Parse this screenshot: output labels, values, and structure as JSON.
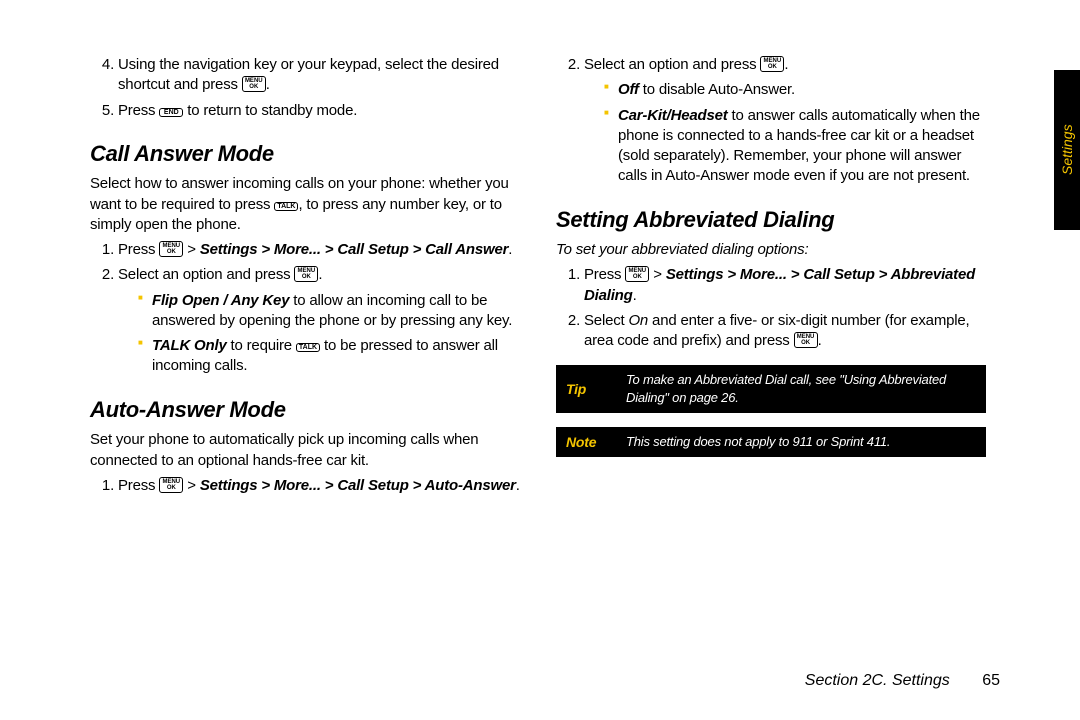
{
  "sideTab": "Settings",
  "footer": {
    "section": "Section 2C. Settings",
    "page": "65"
  },
  "keys": {
    "menuok": {
      "l1": "MENU",
      "l2": "OK"
    },
    "end": {
      "l1": "END",
      "l2": null
    },
    "talk": {
      "l1": "TALK",
      "l2": null
    }
  },
  "left": {
    "step4a": "Using the navigation key or your keypad, select the desired shortcut and press ",
    "step4b": ".",
    "step5a": "Press ",
    "step5b": " to return to standby mode.",
    "h1": "Call Answer Mode",
    "p1a": "Select how to answer incoming calls on your phone: whether you want to be required to press ",
    "p1b": ", to press any number key, or to simply open the phone.",
    "s1a": "Press ",
    "s1b": " > ",
    "s1pathItalic": "Settings > More... > Call Setup > Call Answer",
    "s1c": ".",
    "s2a": "Select an option and press ",
    "s2b": ".",
    "sub1bold": "Flip Open / Any Key",
    "sub1txt": " to allow an incoming call to be answered by opening the phone or by pressing any key.",
    "sub2bold": "TALK Only",
    "sub2a": " to require ",
    "sub2b": " to be pressed to answer all incoming calls.",
    "h2": "Auto-Answer Mode",
    "p2": "Set your phone to automatically pick up incoming calls when connected to an optional hands-free car kit.",
    "a1a": "Press ",
    "a1b": " > ",
    "a1pathItalic": "Settings > More... > Call Setup > Auto-Answer",
    "a1c": "."
  },
  "right": {
    "r2a": "Select an option and press ",
    "r2b": ".",
    "rsub1bold": "Off",
    "rsub1txt": " to disable Auto-Answer.",
    "rsub2bold": "Car-Kit/Headset",
    "rsub2txt": " to answer calls automatically when the phone is connected to a hands-free car kit or a headset (sold separately). Remember, your phone will answer calls in Auto-Answer mode even if you are not present.",
    "h3": "Setting Abbreviated Dialing",
    "p3": "To set your abbreviated dialing options:",
    "d1a": "Press ",
    "d1b": " > ",
    "d1pathItalic": "Settings > More... > Call Setup > Abbreviated Dialing",
    "d1c": ".",
    "d2a": "Select ",
    "d2on": "On",
    "d2b": " and enter a five- or six-digit number (for example, area code and prefix) and press ",
    "d2c": ".",
    "tipLabel": "Tip",
    "tipBody": "To make an Abbreviated Dial call, see \"Using Abbreviated Dialing\" on page 26.",
    "noteLabel": "Note",
    "noteBody": "This setting does not apply to 911 or Sprint 411."
  }
}
